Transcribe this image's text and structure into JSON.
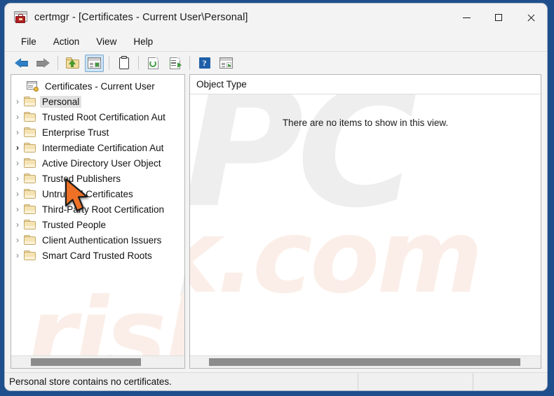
{
  "window": {
    "title": "certmgr - [Certificates - Current User\\Personal]",
    "icon": "certmgr-icon",
    "controls": {
      "minimize": "minimize-button",
      "maximize": "maximize-button",
      "close": "close-button"
    }
  },
  "menubar": {
    "items": [
      {
        "label": "File",
        "name": "menu-file"
      },
      {
        "label": "Action",
        "name": "menu-action"
      },
      {
        "label": "View",
        "name": "menu-view"
      },
      {
        "label": "Help",
        "name": "menu-help"
      }
    ]
  },
  "toolbar": {
    "buttons": [
      {
        "name": "back-button",
        "icon": "back-arrow-icon"
      },
      {
        "name": "forward-button",
        "icon": "forward-arrow-icon"
      },
      {
        "name": "up-one-level-button",
        "icon": "folder-up-icon"
      },
      {
        "name": "show-hide-console-tree-button",
        "icon": "console-tree-icon",
        "selected": true
      },
      {
        "name": "properties-button",
        "icon": "clipboard-icon"
      },
      {
        "name": "refresh-button",
        "icon": "refresh-page-icon"
      },
      {
        "name": "export-list-button",
        "icon": "export-list-icon"
      },
      {
        "name": "help-button",
        "icon": "help-question-icon"
      },
      {
        "name": "show-action-pane-button",
        "icon": "action-pane-icon"
      }
    ]
  },
  "tree": {
    "root": {
      "label": "Certificates - Current User",
      "icon": "certificates-console-icon"
    },
    "items": [
      {
        "label": "Personal",
        "selected": true,
        "chevron": "›"
      },
      {
        "label": "Trusted Root Certification Aut",
        "selected": false,
        "chevron": "›"
      },
      {
        "label": "Enterprise Trust",
        "selected": false,
        "chevron": "›"
      },
      {
        "label": "Intermediate Certification Aut",
        "selected": false,
        "chevron": "›",
        "hot": true
      },
      {
        "label": "Active Directory User Object",
        "selected": false,
        "chevron": "›"
      },
      {
        "label": "Trusted Publishers",
        "selected": false,
        "chevron": "›"
      },
      {
        "label": "Untrusted Certificates",
        "selected": false,
        "chevron": "›"
      },
      {
        "label": "Third-Party Root Certification",
        "selected": false,
        "chevron": "›"
      },
      {
        "label": "Trusted People",
        "selected": false,
        "chevron": "›"
      },
      {
        "label": "Client Authentication Issuers",
        "selected": false,
        "chevron": "›"
      },
      {
        "label": "Smart Card Trusted Roots",
        "selected": false,
        "chevron": "›"
      }
    ]
  },
  "list": {
    "columns": [
      "Object Type"
    ],
    "empty_message": "There are no items to show in this view.",
    "rows": []
  },
  "statusbar": {
    "segments": [
      "Personal store contains no certificates.",
      "",
      ""
    ]
  },
  "watermark": {
    "part1": "PC",
    "part2": "risk.com"
  },
  "colors": {
    "desktop": "#1f4e8c",
    "window": "#f3f3f3",
    "selection": "#e2e2e2",
    "toolbar_selected": "#cce4f7",
    "folder": "#f5e3b3",
    "cursor": "#ef7126"
  }
}
